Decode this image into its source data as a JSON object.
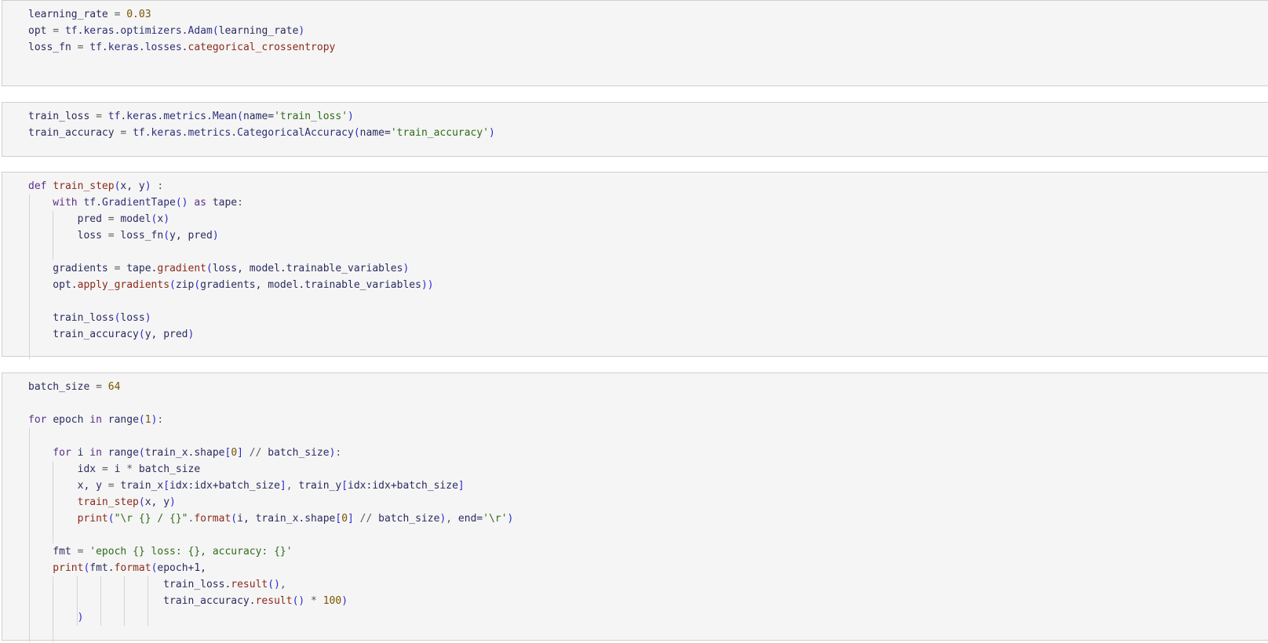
{
  "cells": [
    {
      "lines": [
        [
          [
            "learning_rate",
            "var"
          ],
          [
            " = ",
            "op"
          ],
          [
            "0.03",
            "num"
          ]
        ],
        [
          [
            "opt",
            "var"
          ],
          [
            " = ",
            "op"
          ],
          [
            "tf.keras.optimizers.",
            "attr"
          ],
          [
            "Adam",
            "attr"
          ],
          [
            "(",
            "bracket"
          ],
          [
            "learning_rate",
            "var"
          ],
          [
            ")",
            "bracket"
          ]
        ],
        [
          [
            "loss_fn",
            "var"
          ],
          [
            " = ",
            "op"
          ],
          [
            "tf.keras.losses.",
            "attr"
          ],
          [
            "categorical_crossentropy",
            "func"
          ]
        ]
      ]
    },
    {
      "lines": [
        [
          [
            "train_loss",
            "var"
          ],
          [
            " = ",
            "op"
          ],
          [
            "tf.keras.metrics.",
            "attr"
          ],
          [
            "Mean",
            "attr"
          ],
          [
            "(",
            "bracket"
          ],
          [
            "name=",
            "var"
          ],
          [
            "'train_loss'",
            "str"
          ],
          [
            ")",
            "bracket"
          ]
        ],
        [
          [
            "train_accuracy",
            "var"
          ],
          [
            " = ",
            "op"
          ],
          [
            "tf.keras.metrics.",
            "attr"
          ],
          [
            "CategoricalAccuracy",
            "attr"
          ],
          [
            "(",
            "bracket"
          ],
          [
            "name=",
            "var"
          ],
          [
            "'train_accuracy'",
            "str"
          ],
          [
            ")",
            "bracket"
          ]
        ]
      ]
    },
    {
      "lines": [
        [
          [
            "def ",
            "kw"
          ],
          [
            "train_step",
            "func"
          ],
          [
            "(",
            "bracket"
          ],
          [
            "x, y",
            "var"
          ],
          [
            ")",
            "bracket"
          ],
          [
            " :",
            "op"
          ]
        ],
        [
          [
            "    with ",
            "kw"
          ],
          [
            "tf.",
            "attr"
          ],
          [
            "GradientTape",
            "attr"
          ],
          [
            "()",
            "bracket"
          ],
          [
            " as ",
            "kw"
          ],
          [
            "tape",
            "var"
          ],
          [
            ":",
            "op"
          ]
        ],
        [
          [
            "        pred",
            "var"
          ],
          [
            " = ",
            "op"
          ],
          [
            "model",
            "var"
          ],
          [
            "(",
            "bracket"
          ],
          [
            "x",
            "var"
          ],
          [
            ")",
            "bracket"
          ]
        ],
        [
          [
            "        loss",
            "var"
          ],
          [
            " = ",
            "op"
          ],
          [
            "loss_fn",
            "var"
          ],
          [
            "(",
            "bracket"
          ],
          [
            "y, pred",
            "var"
          ],
          [
            ")",
            "bracket"
          ]
        ],
        [],
        [
          [
            "    gradients",
            "var"
          ],
          [
            " = ",
            "op"
          ],
          [
            "tape.",
            "var"
          ],
          [
            "gradient",
            "func"
          ],
          [
            "(",
            "bracket"
          ],
          [
            "loss, model.trainable_variables",
            "var"
          ],
          [
            ")",
            "bracket"
          ]
        ],
        [
          [
            "    opt.",
            "var"
          ],
          [
            "apply_gradients",
            "func"
          ],
          [
            "(",
            "bracket"
          ],
          [
            "zip",
            "var"
          ],
          [
            "(",
            "bracket"
          ],
          [
            "gradients, model.trainable_variables",
            "var"
          ],
          [
            "))",
            "bracket"
          ]
        ],
        [],
        [
          [
            "    train_loss",
            "var"
          ],
          [
            "(",
            "bracket"
          ],
          [
            "loss",
            "var"
          ],
          [
            ")",
            "bracket"
          ]
        ],
        [
          [
            "    train_accuracy",
            "var"
          ],
          [
            "(",
            "bracket"
          ],
          [
            "y, pred",
            "var"
          ],
          [
            ")",
            "bracket"
          ]
        ]
      ]
    },
    {
      "lines": [
        [
          [
            "batch_size",
            "var"
          ],
          [
            " = ",
            "op"
          ],
          [
            "64",
            "num"
          ]
        ],
        [],
        [
          [
            "for ",
            "kw"
          ],
          [
            "epoch",
            "var"
          ],
          [
            " in ",
            "kw"
          ],
          [
            "range",
            "var"
          ],
          [
            "(",
            "bracket"
          ],
          [
            "1",
            "num"
          ],
          [
            ")",
            "bracket"
          ],
          [
            ":",
            "op"
          ]
        ],
        [],
        [
          [
            "    for ",
            "kw"
          ],
          [
            "i",
            "var"
          ],
          [
            " in ",
            "kw"
          ],
          [
            "range",
            "var"
          ],
          [
            "(",
            "bracket"
          ],
          [
            "train_x.shape",
            "var"
          ],
          [
            "[",
            "bracket"
          ],
          [
            "0",
            "num"
          ],
          [
            "]",
            "bracket"
          ],
          [
            " // ",
            "op"
          ],
          [
            "batch_size",
            "var"
          ],
          [
            ")",
            "bracket"
          ],
          [
            ":",
            "op"
          ]
        ],
        [
          [
            "        idx",
            "var"
          ],
          [
            " = ",
            "op"
          ],
          [
            "i",
            "var"
          ],
          [
            " * ",
            "op"
          ],
          [
            "batch_size",
            "var"
          ]
        ],
        [
          [
            "        x, y",
            "var"
          ],
          [
            " = ",
            "op"
          ],
          [
            "train_x",
            "var"
          ],
          [
            "[",
            "bracket"
          ],
          [
            "idx:idx+batch_size",
            "var"
          ],
          [
            "]",
            "bracket"
          ],
          [
            ", ",
            "op"
          ],
          [
            "train_y",
            "var"
          ],
          [
            "[",
            "bracket"
          ],
          [
            "idx:idx+batch_size",
            "var"
          ],
          [
            "]",
            "bracket"
          ]
        ],
        [
          [
            "        train_step",
            "func"
          ],
          [
            "(",
            "bracket"
          ],
          [
            "x, y",
            "var"
          ],
          [
            ")",
            "bracket"
          ]
        ],
        [
          [
            "        print",
            "func"
          ],
          [
            "(",
            "bracket"
          ],
          [
            "\"\\r {} / {}\"",
            "str"
          ],
          [
            ".",
            "op"
          ],
          [
            "format",
            "func"
          ],
          [
            "(",
            "bracket"
          ],
          [
            "i, train_x.shape",
            "var"
          ],
          [
            "[",
            "bracket"
          ],
          [
            "0",
            "num"
          ],
          [
            "]",
            "bracket"
          ],
          [
            " // ",
            "op"
          ],
          [
            "batch_size",
            "var"
          ],
          [
            ")",
            "bracket"
          ],
          [
            ", ",
            "op"
          ],
          [
            "end=",
            "var"
          ],
          [
            "'\\r'",
            "str"
          ],
          [
            ")",
            "bracket"
          ]
        ],
        [],
        [
          [
            "    fmt",
            "var"
          ],
          [
            " = ",
            "op"
          ],
          [
            "'epoch {} loss: {}, accuracy: {}'",
            "str"
          ]
        ],
        [
          [
            "    print",
            "func"
          ],
          [
            "(",
            "bracket"
          ],
          [
            "fmt.",
            "var"
          ],
          [
            "format",
            "func"
          ],
          [
            "(",
            "bracket"
          ],
          [
            "epoch+1,",
            "var"
          ]
        ],
        [
          [
            "                      train_loss.",
            "var"
          ],
          [
            "result",
            "func"
          ],
          [
            "()",
            "bracket"
          ],
          [
            ",",
            "op"
          ]
        ],
        [
          [
            "                      train_accuracy.",
            "var"
          ],
          [
            "result",
            "func"
          ],
          [
            "()",
            "bracket"
          ],
          [
            " * ",
            "op"
          ],
          [
            "100",
            "num"
          ],
          [
            ")",
            "bracket"
          ]
        ],
        [
          [
            "        )",
            "bracket"
          ]
        ]
      ]
    }
  ]
}
